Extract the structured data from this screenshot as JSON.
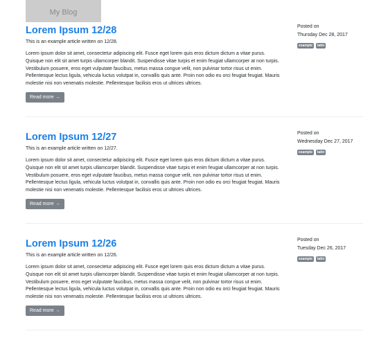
{
  "logo": "My Blog",
  "read_more": "Read more →",
  "posted_on": "Posted on",
  "body": "Lorem ipsum dolor sit amet, consectetur adipiscing elit. Fusce eget lorem quis eros dictum dictum a vitae purus. Quisque non elit sit amet turpis ullamcorper blandit. Suspendisse vitae turpis et enim feugiat ullamcorper at non turpis. Vestibulum posuere, eros eget vulputate faucibus, metus massa congue velit, non pulvinar tortor risus ut enim. Pellentesque lectus ligula, vehicula luctus volutpat in, convallis quis ante. Proin non odio eu orci feugiat feugiat. Mauris molestie nisi non venenatis molestie. Pellentesque facilisis eros ut ultrices ultrices.",
  "posts": [
    {
      "title": "Lorem Ipsum 12/28",
      "subtitle": "This is an example article written on 12/28.",
      "date": "Thursday Dec 28, 2017",
      "tags": [
        "example",
        "latin"
      ]
    },
    {
      "title": "Lorem Ipsum 12/27",
      "subtitle": "This is an example article written on 12/27.",
      "date": "Wednesday Dec 27, 2017",
      "tags": [
        "example",
        "latin"
      ]
    },
    {
      "title": "Lorem Ipsum 12/26",
      "subtitle": "This is an example article written on 12/26.",
      "date": "Tuesday Dec 26, 2017",
      "tags": [
        "example",
        "latin"
      ]
    }
  ]
}
